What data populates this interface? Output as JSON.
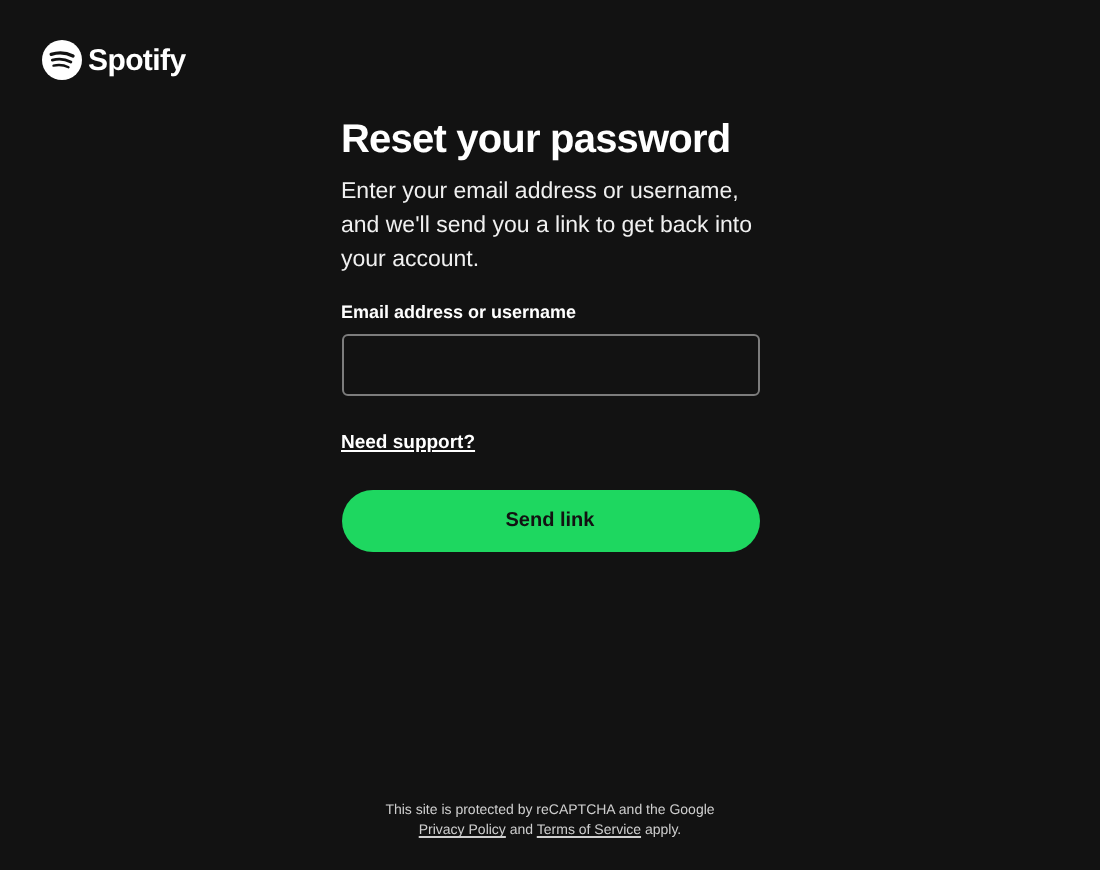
{
  "logo": {
    "wordmark": "Spotify"
  },
  "form": {
    "title": "Reset your password",
    "description": "Enter your email address or username, and we'll send you a link to get back into your account.",
    "field_label": "Email address or username",
    "support_link": "Need support?",
    "submit_button": "Send link"
  },
  "footer": {
    "text_before": "This site is protected by reCAPTCHA and the Google",
    "link_1": "Privacy Policy",
    "middle": "and",
    "link_2": "Terms of Service",
    "text_after": "apply."
  }
}
